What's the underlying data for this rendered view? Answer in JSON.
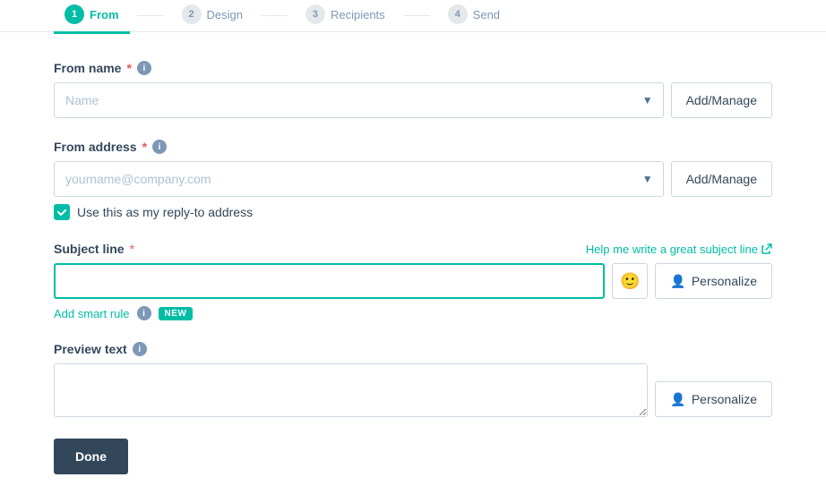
{
  "nav": {
    "steps": [
      {
        "id": "from",
        "label": "From",
        "number": "1",
        "active": true,
        "completed": false
      },
      {
        "id": "design",
        "label": "Design",
        "number": "2",
        "active": false,
        "completed": false
      },
      {
        "id": "recipients",
        "label": "Recipients",
        "number": "3",
        "active": false,
        "completed": false
      },
      {
        "id": "send",
        "label": "Send",
        "number": "4",
        "active": false,
        "completed": false
      }
    ]
  },
  "form": {
    "from_name": {
      "label": "From name",
      "required": true,
      "placeholder": "Name",
      "btn_label": "Add/Manage"
    },
    "from_address": {
      "label": "From address",
      "required": true,
      "placeholder": "yourname@company.com",
      "btn_label": "Add/Manage"
    },
    "reply_checkbox": {
      "label": "Use this as my reply-to address",
      "checked": true
    },
    "subject_line": {
      "label": "Subject line",
      "required": true,
      "help_text": "Help me write a great subject line",
      "placeholder": "",
      "btn_emoji_aria": "emoji picker",
      "btn_personalize_label": "Personalize"
    },
    "smart_rule": {
      "link_label": "Add smart rule",
      "badge_label": "NEW"
    },
    "preview_text": {
      "label": "Preview text",
      "placeholder": "",
      "btn_personalize_label": "Personalize"
    },
    "done_btn": "Done"
  }
}
